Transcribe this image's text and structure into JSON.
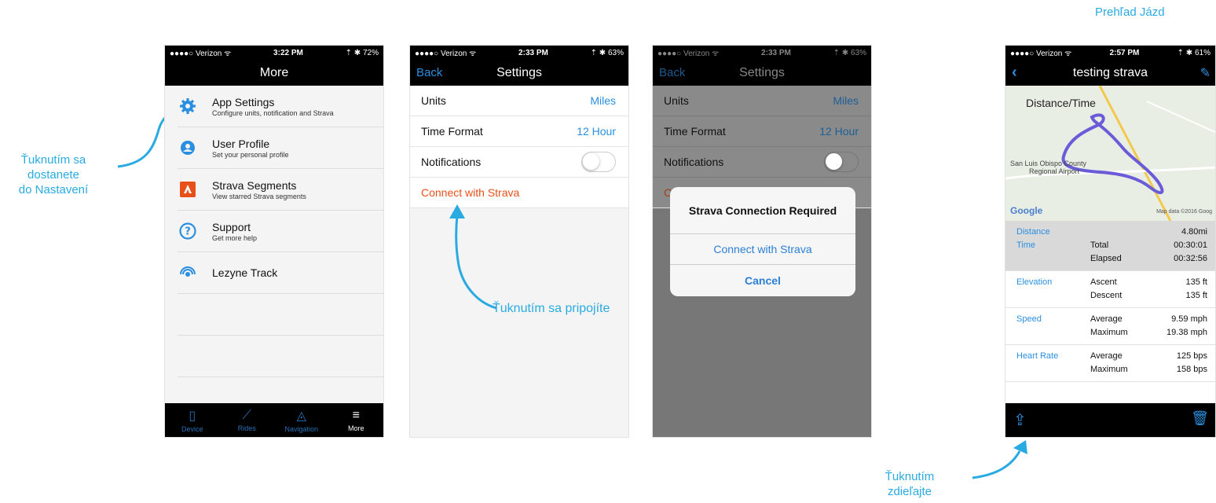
{
  "page_title": "Prehľad Jázd",
  "annotations": {
    "settings_hint": [
      "Ťuknutím sa",
      "dostanete",
      "do Nastavení"
    ],
    "connect_hint": "Ťuknutím sa pripojíte",
    "share_hint": [
      "Ťuknutím",
      "zdieľajte"
    ]
  },
  "colors": {
    "annotation": "#29abe2",
    "link_blue": "#2a8fe0",
    "strava_orange": "#e8501a"
  },
  "screen_more": {
    "status": {
      "carrier": "●●●●○ Verizon ᯤ",
      "time": "3:22 PM",
      "battery": "⇡ ✱ 72%"
    },
    "title": "More",
    "items": [
      {
        "icon": "gear-icon",
        "label": "App Settings",
        "sub": "Configure units, notification and Strava"
      },
      {
        "icon": "user-icon",
        "label": "User Profile",
        "sub": "Set your personal profile"
      },
      {
        "icon": "strava-icon",
        "label": "Strava Segments",
        "sub": "View starred Strava segments"
      },
      {
        "icon": "help-icon",
        "label": "Support",
        "sub": "Get more help"
      },
      {
        "icon": "track-icon",
        "label": "Lezyne Track",
        "sub": ""
      }
    ],
    "tabs": [
      {
        "icon": "device-icon",
        "label": "Device"
      },
      {
        "icon": "rides-icon",
        "label": "Rides"
      },
      {
        "icon": "navigation-icon",
        "label": "Navigation"
      },
      {
        "icon": "menu-icon",
        "label": "More"
      }
    ]
  },
  "screen_settings": {
    "status": {
      "carrier": "●●●●○ Verizon ᯤ",
      "time": "2:33 PM",
      "battery": "⇡ ✱ 63%"
    },
    "back": "Back",
    "title": "Settings",
    "units_label": "Units",
    "units_value": "Miles",
    "time_label": "Time Format",
    "time_value": "12 Hour",
    "notifications_label": "Notifications",
    "strava_label": "Connect with Strava"
  },
  "screen_dialog": {
    "dialog_title": "Strava Connection Required",
    "connect": "Connect with Strava",
    "cancel": "Cancel",
    "partial_label": "C"
  },
  "screen_ride": {
    "status": {
      "carrier": "●●●●○ Verizon ᯤ",
      "time": "2:57 PM",
      "battery": "⇡ ✱ 61%"
    },
    "title": "testing strava",
    "map_title": "Distance/Time",
    "map_place": "San Luis Obispo County",
    "map_place2": "Regional Airport",
    "google": "Google",
    "map_data": "Map data ©2016 Goog",
    "stats": [
      {
        "label": "Distance",
        "rows": [
          [
            "",
            "4.80mi"
          ]
        ]
      },
      {
        "label": "Time",
        "rows": [
          [
            "Total",
            "00:30:01"
          ],
          [
            "Elapsed",
            "00:32:56"
          ]
        ]
      },
      {
        "label": "Elevation",
        "rows": [
          [
            "Ascent",
            "135 ft"
          ],
          [
            "Descent",
            "135 ft"
          ]
        ]
      },
      {
        "label": "Speed",
        "rows": [
          [
            "Average",
            "9.59 mph"
          ],
          [
            "Maximum",
            "19.38 mph"
          ]
        ]
      },
      {
        "label": "Heart Rate",
        "rows": [
          [
            "Average",
            "125 bps"
          ],
          [
            "Maximum",
            "158 bps"
          ]
        ]
      }
    ]
  }
}
